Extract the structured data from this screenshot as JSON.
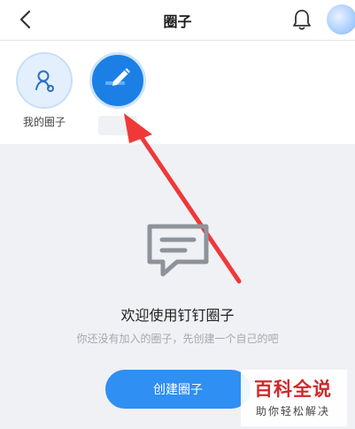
{
  "header": {
    "title": "圈子"
  },
  "circles": {
    "my_circle_label": "我的圈子"
  },
  "empty_state": {
    "welcome": "欢迎使用钉钉圈子",
    "hint": "你还没有加入的圈子，先创建一个自己的吧",
    "create_button": "创建圈子"
  },
  "watermark": {
    "main": "百科全说",
    "sub": "助你轻松解决"
  },
  "colors": {
    "accent": "#2f8ff2",
    "arrow": "#f03838",
    "watermark_red": "#d0282a"
  },
  "icons": [
    "back-icon",
    "bell-icon",
    "people-icon",
    "pencil-icon",
    "message-icon"
  ]
}
